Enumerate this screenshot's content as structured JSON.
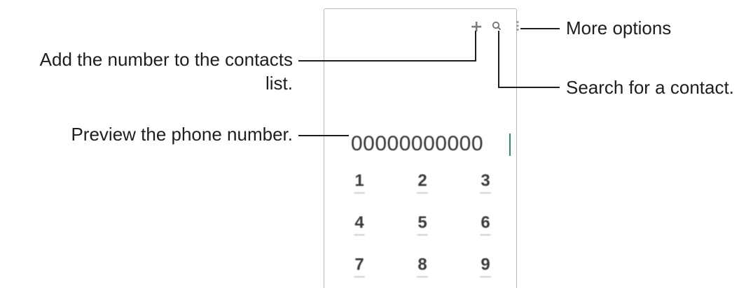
{
  "callouts": {
    "add_contact": {
      "line1": "Add the number to the contacts",
      "line2": "list."
    },
    "preview_number": "Preview the phone number.",
    "more_options": "More options",
    "search_contact": "Search for a contact."
  },
  "dialer": {
    "number_display": "00000000000",
    "keys": [
      {
        "digit": "1"
      },
      {
        "digit": "2"
      },
      {
        "digit": "3"
      },
      {
        "digit": "4"
      },
      {
        "digit": "5"
      },
      {
        "digit": "6"
      },
      {
        "digit": "7"
      },
      {
        "digit": "8"
      },
      {
        "digit": "9"
      }
    ]
  },
  "icons": {
    "add": "plus-icon",
    "search": "search-icon",
    "more": "more-options-icon"
  }
}
